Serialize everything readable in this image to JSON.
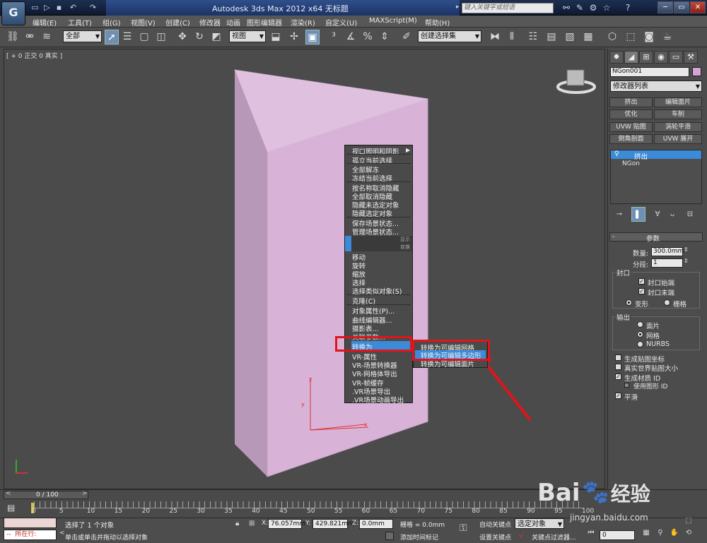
{
  "window": {
    "title": "Autodesk 3ds Max  2012 x64      无标题",
    "search_placeholder": "键入关键字或短语",
    "logo": "G"
  },
  "menubar": [
    "编辑(E)",
    "工具(T)",
    "组(G)",
    "视图(V)",
    "创建(C)",
    "修改器",
    "动画",
    "图形编辑器",
    "渲染(R)",
    "自定义(U)",
    "MAXScript(M)",
    "帮助(H)"
  ],
  "toolbar": {
    "selection_filter": "全部",
    "ref_coord": "视图",
    "named_selection": "创建选择集"
  },
  "viewport": {
    "label": "[ + 0 正交 0 真实 ]",
    "axis_x": "x",
    "axis_y": "y",
    "axis_z": "z"
  },
  "context_menu": {
    "items": [
      "视口照明和阴影",
      "孤立当前选择",
      "全部解冻",
      "冻结当前选择",
      "按名称取消隐藏",
      "全部取消隐藏",
      "隐藏未选定对象",
      "隐藏选定对象",
      "保存场景状态...",
      "管理场景状态...",
      "显示",
      "变换",
      "移动",
      "旋转",
      "缩放",
      "选择",
      "选择类似对象(S)",
      "克隆(C)",
      "对象属性(P)...",
      "曲线编辑器...",
      "摄影表...",
      "关联参数...",
      "转换为",
      "VR-属性",
      "VR-场景转换器",
      "VR-网格体导出",
      "VR-帧缓存",
      ".VR场景导出",
      ".VR场景动画导出"
    ],
    "submenu": [
      "转换为可编辑网格",
      "转换为可编辑多边形",
      "转换为可编辑面片"
    ]
  },
  "command_panel": {
    "object_name": "NGon001",
    "modifier_list": "修改器列表",
    "buttons": [
      "挤出",
      "编辑面片",
      "优化",
      "车削",
      "UVW 贴图",
      "涡轮平滑",
      "倒角剖面",
      "UVW 展开"
    ],
    "stack": [
      "挤出",
      "NGon"
    ],
    "params_title": "参数",
    "amount_label": "数量:",
    "amount_value": "300.0mm",
    "segments_label": "分段:",
    "segments_value": "1",
    "cap_group": "封口",
    "cap_start": "封口始端",
    "cap_end": "封口末端",
    "morph": "变形",
    "grid": "栅格",
    "output_group": "输出",
    "out_patch": "面片",
    "out_mesh": "网格",
    "out_nurbs": "NURBS",
    "gen_map": "生成贴图坐标",
    "real_world": "真实世界贴图大小",
    "gen_mat": "生成材质 ID",
    "use_shape": "使用图形 ID",
    "smooth": "平滑"
  },
  "timeline": {
    "frame": "0 / 100",
    "ticks": [
      "0",
      "5",
      "10",
      "15",
      "20",
      "25",
      "30",
      "35",
      "40",
      "45",
      "50",
      "55",
      "60",
      "65",
      "70",
      "75",
      "80",
      "85",
      "90",
      "95",
      "100"
    ]
  },
  "status": {
    "maxscript": "所在行:",
    "selected": "选择了 1 个对象",
    "prompt": "单击或单击并拖动以选择对象",
    "x_label": "X:",
    "x_value": "76.057mm",
    "y_label": "Y:",
    "y_value": "429.821mm",
    "z_label": "Z:",
    "z_value": "0.0mm",
    "grid": "栅格 = 0.0mm",
    "add_tag": "添加时间标记",
    "auto_key": "自动关键点",
    "selected_obj": "选定对象",
    "set_key": "设置关键点",
    "key_filters": "关键点过滤器...",
    "frame_value": "0"
  },
  "watermark": {
    "brand": "Bai",
    "brand2": "经验",
    "url": "jingyan.baidu.com"
  }
}
